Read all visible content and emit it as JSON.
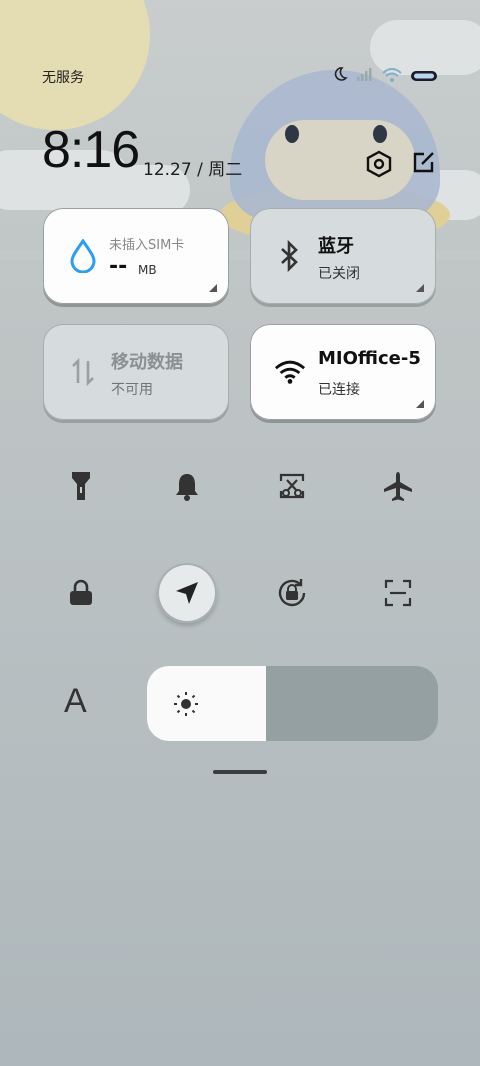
{
  "status_bar": {
    "carrier_text": "无服务",
    "icons": [
      "moon-icon",
      "signal-icon",
      "wifi-icon",
      "battery-icon"
    ]
  },
  "header": {
    "time": "8:16",
    "date": "12.27 / 周二",
    "settings_icon": "hexagon-settings-icon",
    "edit_icon": "edit-icon"
  },
  "tiles": {
    "data_usage": {
      "title": "未插入SIM卡",
      "value": "--",
      "unit": "MB",
      "icon": "water-drop-icon",
      "accent": "#2a9df4"
    },
    "bluetooth": {
      "title": "蓝牙",
      "status": "已关闭",
      "icon": "bluetooth-icon"
    },
    "mobile_data": {
      "title": "移动数据",
      "status": "不可用",
      "icon": "data-arrows-icon"
    },
    "wifi": {
      "title": "MIOffice-5",
      "status": "已连接",
      "icon": "wifi-icon"
    }
  },
  "toggles_row1": [
    "flashlight-icon",
    "bell-icon",
    "screenshot-icon",
    "airplane-icon"
  ],
  "toggles_row2": [
    "lock-icon",
    "location-icon",
    "rotation-lock-icon",
    "scan-icon"
  ],
  "font_label": "A",
  "brightness": {
    "level": 0.41,
    "icon": "sun-icon"
  }
}
